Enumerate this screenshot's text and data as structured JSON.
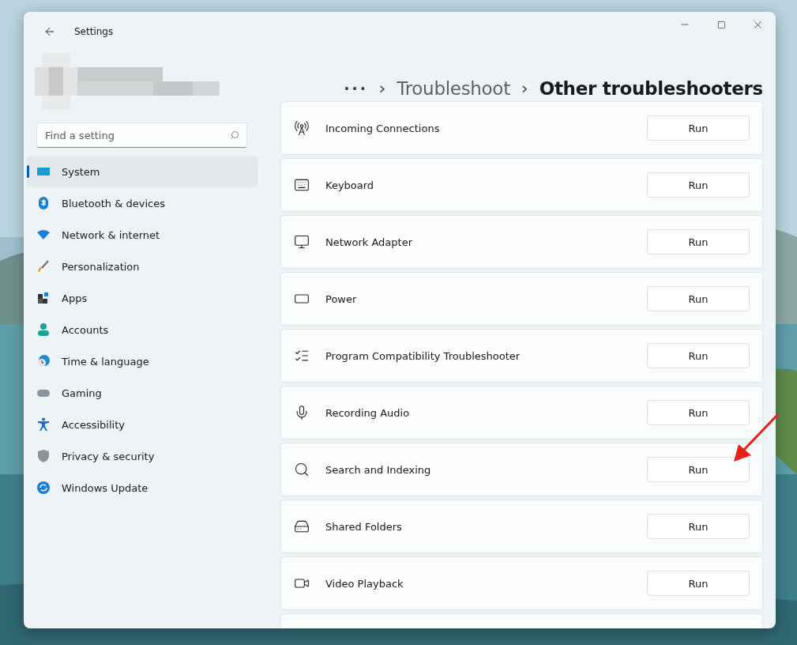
{
  "window": {
    "title": "Settings"
  },
  "search": {
    "placeholder": "Find a setting"
  },
  "sidebar": {
    "items": [
      {
        "label": "System",
        "selected": true
      },
      {
        "label": "Bluetooth & devices",
        "selected": false
      },
      {
        "label": "Network & internet",
        "selected": false
      },
      {
        "label": "Personalization",
        "selected": false
      },
      {
        "label": "Apps",
        "selected": false
      },
      {
        "label": "Accounts",
        "selected": false
      },
      {
        "label": "Time & language",
        "selected": false
      },
      {
        "label": "Gaming",
        "selected": false
      },
      {
        "label": "Accessibility",
        "selected": false
      },
      {
        "label": "Privacy & security",
        "selected": false
      },
      {
        "label": "Windows Update",
        "selected": false
      }
    ]
  },
  "breadcrumb": {
    "more": "•••",
    "separator": "›",
    "parent": "Troubleshoot",
    "current": "Other troubleshooters"
  },
  "troubleshooters": [
    {
      "name": "Incoming Connections",
      "button": "Run"
    },
    {
      "name": "Keyboard",
      "button": "Run"
    },
    {
      "name": "Network Adapter",
      "button": "Run"
    },
    {
      "name": "Power",
      "button": "Run"
    },
    {
      "name": "Program Compatibility Troubleshooter",
      "button": "Run"
    },
    {
      "name": "Recording Audio",
      "button": "Run"
    },
    {
      "name": "Search and Indexing",
      "button": "Run"
    },
    {
      "name": "Shared Folders",
      "button": "Run"
    },
    {
      "name": "Video Playback",
      "button": "Run"
    }
  ]
}
